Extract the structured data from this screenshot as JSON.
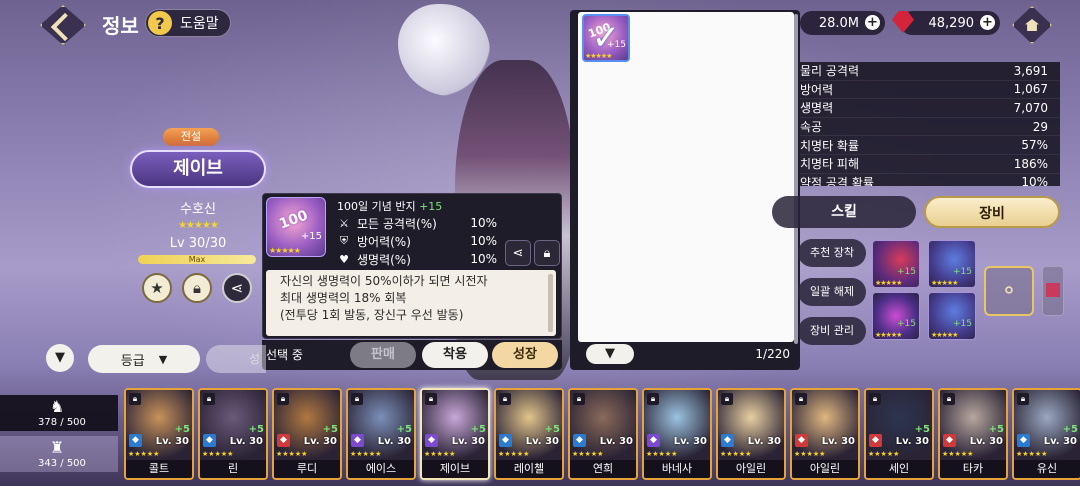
{
  "header": {
    "title": "정보",
    "help_icon": "?",
    "help_label": "도움말"
  },
  "currency": {
    "gold": "28.0M",
    "gems": "48,290",
    "colors": {
      "gem": "#d4243b"
    }
  },
  "character": {
    "grade": "전설",
    "name": "제이브",
    "role": "수호신",
    "stars": "★★★★★",
    "level": "Lv 30/30",
    "level_max_label": "Max"
  },
  "tooltip": {
    "item_img_text": "100",
    "item_plus": "+15",
    "item_name": "100일 기념 반지",
    "item_enh": "+15",
    "stats": [
      {
        "icon": "attack-icon",
        "label": "모든 공격력(%)",
        "value": "10%"
      },
      {
        "icon": "defense-icon",
        "label": "방어력(%)",
        "value": "10%"
      },
      {
        "icon": "heart-icon",
        "label": "생명력(%)",
        "value": "10%"
      }
    ],
    "desc": [
      "자신의 생명력이 50%이하가 되면 시전자",
      "최대 생명력의 18% 회복",
      "(전투당 1회 발동, 장신구 우선 발동)"
    ]
  },
  "actions": {
    "state": "선택 중",
    "sell": "판매",
    "equip": "착용",
    "grow": "성장"
  },
  "inventory": {
    "item_img_text": "100",
    "item_plus": "+15",
    "count": "1/220"
  },
  "stats_panel": [
    {
      "label": "물리 공격력",
      "value": "3,691"
    },
    {
      "label": "방어력",
      "value": "1,067"
    },
    {
      "label": "생명력",
      "value": "7,070"
    },
    {
      "label": "속공",
      "value": "29"
    },
    {
      "label": "치명타 확률",
      "value": "57%"
    },
    {
      "label": "치명타 피해",
      "value": "186%"
    },
    {
      "label": "약점 공격 확률",
      "value": "10%"
    }
  ],
  "tabs": {
    "skill": "스킬",
    "equipment": "장비"
  },
  "side_buttons": [
    "추천 장착",
    "일괄 해제",
    "장비 관리"
  ],
  "equipped": [
    {
      "plus": "+15"
    },
    {
      "plus": "+15"
    },
    {
      "plus": "+15"
    },
    {
      "plus": "+15"
    }
  ],
  "filter": {
    "sort": "등급",
    "sort2": "성",
    "slot1": "378 / 500",
    "slot2": "343 / 500"
  },
  "heroes": [
    {
      "name": "콜트",
      "lv": "Lv. 30",
      "plus": "+5"
    },
    {
      "name": "린",
      "lv": "Lv. 30",
      "plus": "+5"
    },
    {
      "name": "루디",
      "lv": "Lv. 30",
      "plus": "+5"
    },
    {
      "name": "에이스",
      "lv": "Lv. 30",
      "plus": "+5"
    },
    {
      "name": "제이브",
      "lv": "Lv. 30",
      "plus": "+5"
    },
    {
      "name": "레이첼",
      "lv": "Lv. 30",
      "plus": "+5"
    },
    {
      "name": "연희",
      "lv": "Lv. 30",
      "plus": ""
    },
    {
      "name": "바네사",
      "lv": "Lv. 30",
      "plus": ""
    },
    {
      "name": "아일린",
      "lv": "Lv. 30",
      "plus": ""
    },
    {
      "name": "아일린",
      "lv": "Lv. 30",
      "plus": ""
    },
    {
      "name": "세인",
      "lv": "Lv. 30",
      "plus": "+5"
    },
    {
      "name": "타카",
      "lv": "Lv. 30",
      "plus": "+5"
    },
    {
      "name": "유신",
      "lv": "Lv. 30",
      "plus": "+5"
    }
  ]
}
